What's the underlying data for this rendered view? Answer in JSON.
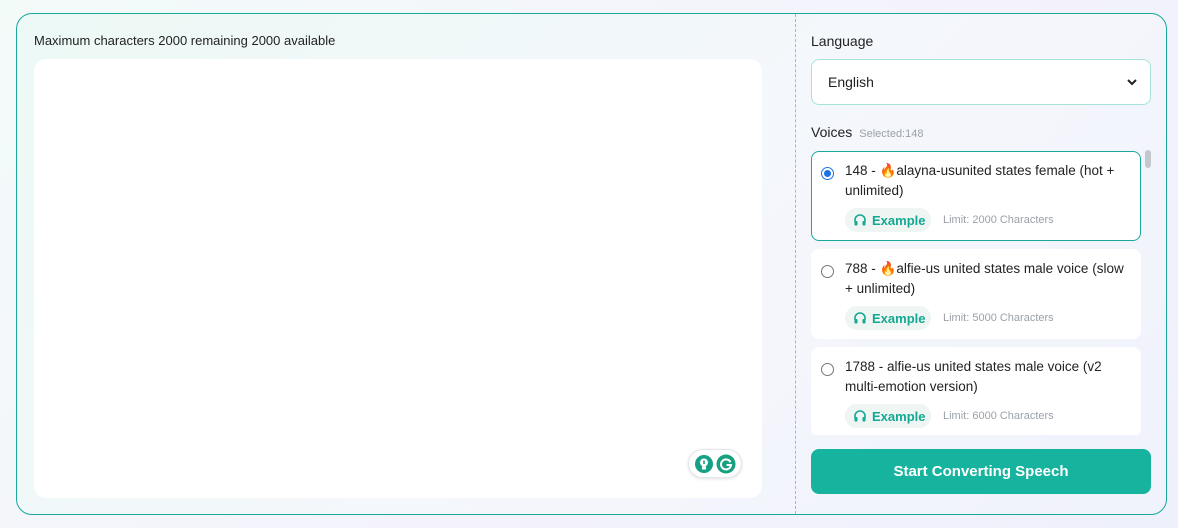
{
  "editor": {
    "char_info": "Maximum characters 2000 remaining 2000 available",
    "text_value": ""
  },
  "language": {
    "label": "Language",
    "selected": "English"
  },
  "voices": {
    "label": "Voices",
    "selected_info": "Selected:148",
    "items": [
      {
        "name_prefix": "148 - ",
        "hot": true,
        "name": "alayna-usunited states female (hot + unlimited)",
        "example_label": "Example",
        "limit": "Limit: 2000 Characters",
        "selected": true
      },
      {
        "name_prefix": "788 - ",
        "hot": true,
        "name": "alfie-us united states male voice (slow + unlimited)",
        "example_label": "Example",
        "limit": "Limit: 5000 Characters",
        "selected": false
      },
      {
        "name_prefix": "1788 - ",
        "hot": false,
        "name": "alfie-us united states male voice (v2 multi-emotion version)",
        "example_label": "Example",
        "limit": "Limit: 6000 Characters",
        "selected": false
      }
    ]
  },
  "actions": {
    "start_label": "Start Converting Speech"
  },
  "colors": {
    "accent": "#16b39e",
    "border": "#1aa89a",
    "radio": "#1a73e8"
  }
}
